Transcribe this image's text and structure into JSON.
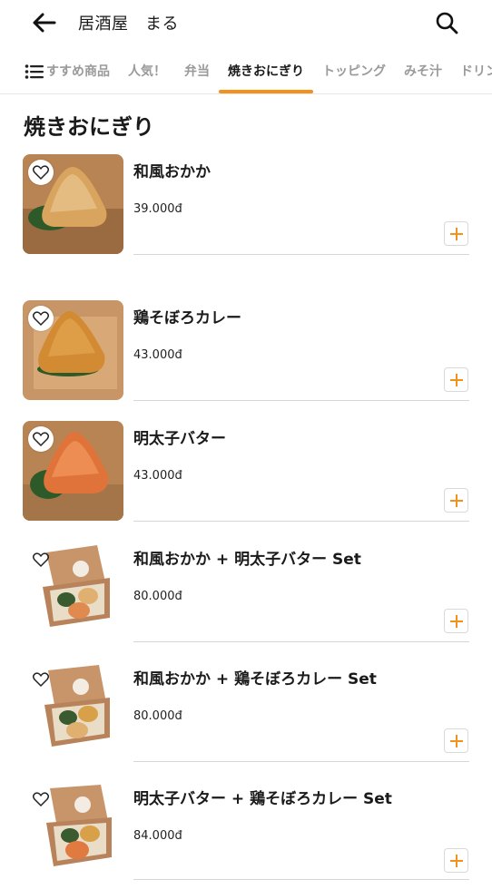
{
  "header": {
    "title": "居酒屋　まる",
    "back_icon": "arrow-left-icon",
    "search_icon": "search-icon"
  },
  "tabs": [
    {
      "label": "すすめ商品",
      "active": false
    },
    {
      "label": "人気！",
      "active": false
    },
    {
      "label": "弁当",
      "active": false
    },
    {
      "label": "焼きおにぎり",
      "active": true
    },
    {
      "label": "トッピング",
      "active": false
    },
    {
      "label": "みそ汁",
      "active": false
    },
    {
      "label": "ドリンク",
      "active": false
    }
  ],
  "section": {
    "title": "焼きおにぎり"
  },
  "items": [
    {
      "name": "和風おかか",
      "price": "39.000đ",
      "image": "onigiri"
    },
    {
      "name": "鶏そぼろカレー",
      "price": "43.000đ",
      "image": "onigiri"
    },
    {
      "name": "明太子バター",
      "price": "43.000đ",
      "image": "onigiri"
    },
    {
      "name": "和風おかか + 明太子バター Set",
      "price": "80.000đ",
      "image": "set-box"
    },
    {
      "name": "和風おかか + 鶏そぼろカレー Set",
      "price": "80.000đ",
      "image": "set-box"
    },
    {
      "name": "明太子バター + 鶏そぼろカレー Set",
      "price": "84.000đ",
      "image": "set-box"
    }
  ],
  "colors": {
    "accent": "#f2911b",
    "text": "#1a1a1a",
    "muted": "#9a9a9a"
  }
}
